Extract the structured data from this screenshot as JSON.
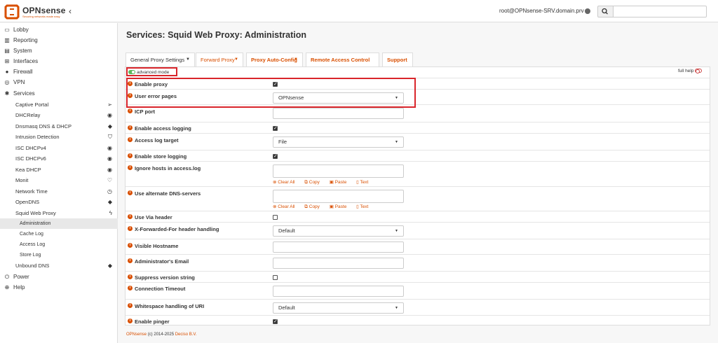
{
  "header": {
    "brand": "OPNsense",
    "brand_sub": "Securing networks made easy",
    "collapse_glyph": "‹",
    "user": "root@OPNsense-SRV.domain.prv",
    "search_placeholder": ""
  },
  "sidebar": {
    "items": [
      {
        "label": "Lobby",
        "icon": "laptop-icon"
      },
      {
        "label": "Reporting",
        "icon": "chart-icon"
      },
      {
        "label": "System",
        "icon": "server-icon"
      },
      {
        "label": "Interfaces",
        "icon": "sitemap-icon"
      },
      {
        "label": "Firewall",
        "icon": "fire-icon"
      },
      {
        "label": "VPN",
        "icon": "globe-icon"
      },
      {
        "label": "Services",
        "icon": "cog-icon"
      }
    ],
    "services_children": [
      {
        "label": "Captive Portal",
        "icon": "paper-plane-icon"
      },
      {
        "label": "DHCRelay",
        "icon": "target-icon"
      },
      {
        "label": "Dnsmasq DNS & DHCP",
        "icon": "tag-icon"
      },
      {
        "label": "Intrusion Detection",
        "icon": "shield-icon"
      },
      {
        "label": "ISC DHCPv4",
        "icon": "target-icon"
      },
      {
        "label": "ISC DHCPv6",
        "icon": "target-icon"
      },
      {
        "label": "Kea DHCP",
        "icon": "target-icon"
      },
      {
        "label": "Monit",
        "icon": "heartbeat-icon"
      },
      {
        "label": "Network Time",
        "icon": "clock-icon"
      },
      {
        "label": "OpenDNS",
        "icon": "tag-icon"
      },
      {
        "label": "Squid Web Proxy",
        "icon": "bolt-icon"
      }
    ],
    "squid_children": [
      {
        "label": "Administration"
      },
      {
        "label": "Cache Log"
      },
      {
        "label": "Access Log"
      },
      {
        "label": "Store Log"
      }
    ],
    "after_items": [
      {
        "label": "Unbound DNS",
        "icon": "tag-icon"
      }
    ],
    "bottom_items": [
      {
        "label": "Power",
        "icon": "plug-icon"
      },
      {
        "label": "Help",
        "icon": "lifebuoy-icon"
      }
    ]
  },
  "main": {
    "title": "Services: Squid Web Proxy: Administration",
    "tabs": [
      {
        "label": "General Proxy Settings"
      },
      {
        "label": "Forward Proxy"
      },
      {
        "label": "Proxy Auto-Config"
      },
      {
        "label": "Remote Access Control Lists"
      },
      {
        "label": "Support"
      }
    ],
    "advanced_mode": "advanced mode",
    "full_help": "full help",
    "fields": [
      {
        "label": "Enable proxy",
        "type": "checkbox",
        "checked": true
      },
      {
        "label": "User error pages",
        "type": "select",
        "value": "OPNsense"
      },
      {
        "label": "ICP port",
        "type": "text",
        "value": ""
      },
      {
        "label": "Enable access logging",
        "type": "checkbox",
        "checked": true
      },
      {
        "label": "Access log target",
        "type": "select",
        "value": "File"
      },
      {
        "label": "Enable store logging",
        "type": "checkbox",
        "checked": true
      },
      {
        "label": "Ignore hosts in access.log",
        "type": "tokens",
        "value": ""
      },
      {
        "label": "Use alternate DNS-servers",
        "type": "tokens",
        "value": ""
      },
      {
        "label": "Use Via header",
        "type": "checkbox",
        "checked": false
      },
      {
        "label": "X-Forwarded-For header handling",
        "type": "select",
        "value": "Default"
      },
      {
        "label": "Visible Hostname",
        "type": "text",
        "value": ""
      },
      {
        "label": "Administrator's Email",
        "type": "text",
        "value": ""
      },
      {
        "label": "Suppress version string",
        "type": "checkbox",
        "checked": false
      },
      {
        "label": "Connection Timeout",
        "type": "text",
        "value": ""
      },
      {
        "label": "Whitespace handling of URI",
        "type": "select",
        "value": "Default"
      },
      {
        "label": "Enable pinger",
        "type": "checkbox",
        "checked": true
      }
    ],
    "token_tools": {
      "clear": "Clear All",
      "copy": "Copy",
      "paste": "Paste",
      "text": "Text"
    }
  },
  "footer": {
    "brand": "OPNsense",
    "text": "(c) 2014-2025",
    "company": "Deciso B.V."
  },
  "colors": {
    "accent": "#d94f00",
    "highlight": "#d9252b",
    "toggle_on": "#5cb85c"
  }
}
